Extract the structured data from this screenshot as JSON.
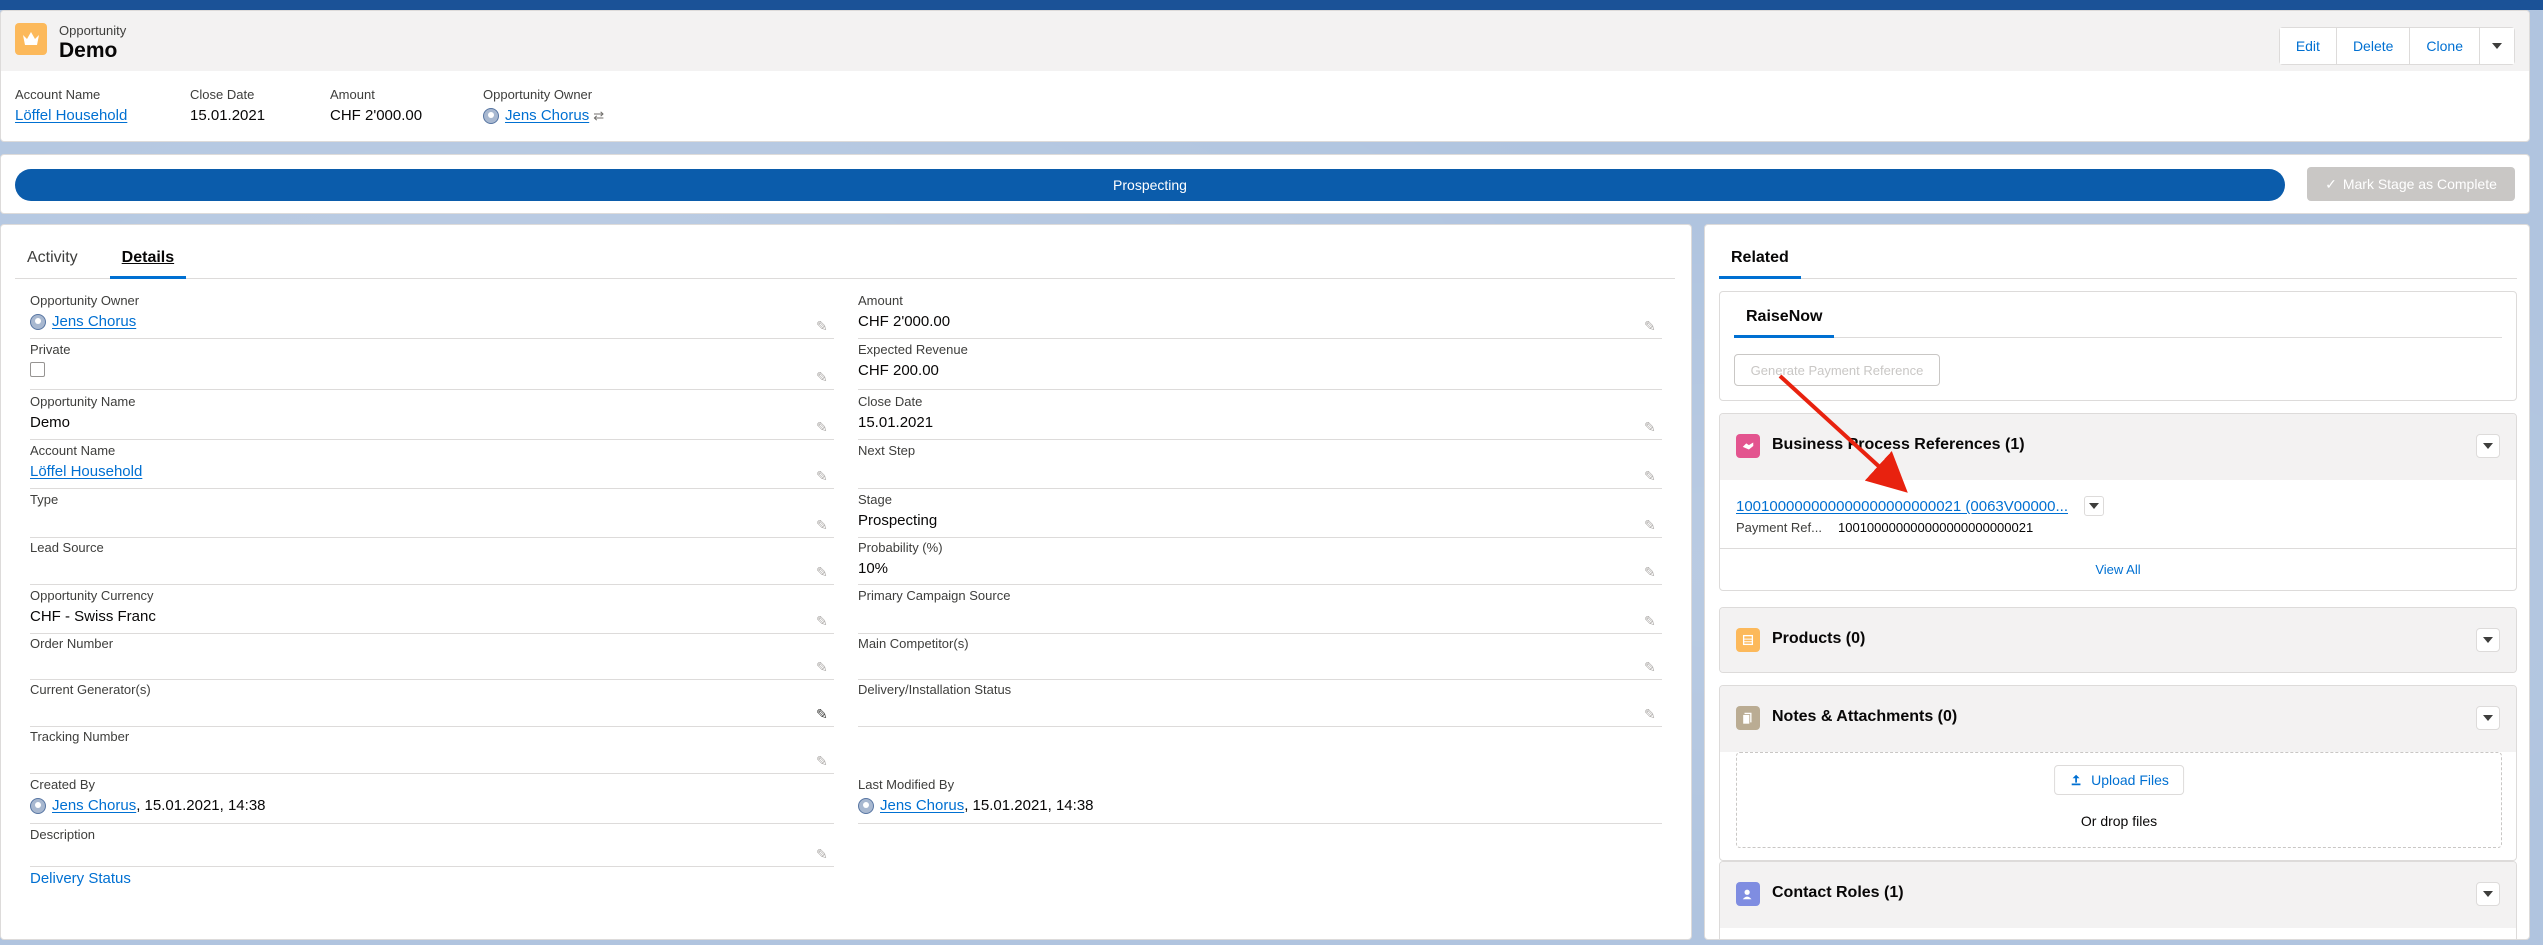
{
  "header": {
    "object_label": "Opportunity",
    "record_title": "Demo",
    "buttons": {
      "edit": "Edit",
      "delete": "Delete",
      "clone": "Clone"
    },
    "highlights": {
      "account_name_label": "Account Name",
      "account_name_value": "Löffel Household",
      "close_date_label": "Close Date",
      "close_date_value": "15.01.2021",
      "amount_label": "Amount",
      "amount_value": "CHF 2'000.00",
      "owner_label": "Opportunity Owner",
      "owner_value": "Jens Chorus"
    }
  },
  "path": {
    "current_stage": "Prospecting",
    "mark_complete_label": "Mark Stage as Complete"
  },
  "details": {
    "tabs": {
      "activity": "Activity",
      "details": "Details"
    },
    "left": [
      {
        "label": "Opportunity Owner",
        "value": "Jens Chorus"
      },
      {
        "label": "Private",
        "value": ""
      },
      {
        "label": "Opportunity Name",
        "value": "Demo"
      },
      {
        "label": "Account Name",
        "value": "Löffel Household"
      },
      {
        "label": "Type",
        "value": ""
      },
      {
        "label": "Lead Source",
        "value": ""
      },
      {
        "label": "Opportunity Currency",
        "value": "CHF - Swiss Franc"
      },
      {
        "label": "Order Number",
        "value": ""
      },
      {
        "label": "Current Generator(s)",
        "value": ""
      },
      {
        "label": "Tracking Number",
        "value": ""
      },
      {
        "label": "Created By",
        "value": "Jens Chorus",
        "suffix": ", 15.01.2021, 14:38"
      },
      {
        "label": "Description",
        "value": ""
      }
    ],
    "right": [
      {
        "label": "Amount",
        "value": "CHF 2'000.00"
      },
      {
        "label": "Expected Revenue",
        "value": "CHF 200.00"
      },
      {
        "label": "Close Date",
        "value": "15.01.2021"
      },
      {
        "label": "Next Step",
        "value": ""
      },
      {
        "label": "Stage",
        "value": "Prospecting"
      },
      {
        "label": "Probability (%)",
        "value": "10%"
      },
      {
        "label": "Primary Campaign Source",
        "value": ""
      },
      {
        "label": "Main Competitor(s)",
        "value": ""
      },
      {
        "label": "Delivery/Installation Status",
        "value": ""
      },
      {
        "label": "Last Modified By",
        "value": "Jens Chorus",
        "suffix": ", 15.01.2021, 14:38"
      }
    ],
    "section_link": "Delivery Status"
  },
  "related": {
    "tab": "Related",
    "raisenow": {
      "tab": "RaiseNow",
      "generate_button": "Generate Payment Reference"
    },
    "business_process_references": {
      "title": "Business Process References (1)",
      "record_link": "100100000000000000000000021 (0063V00000...",
      "field_label": "Payment Ref...",
      "field_value": "100100000000000000000000021",
      "view_all": "View All"
    },
    "products": {
      "title": "Products (0)"
    },
    "notes": {
      "title": "Notes & Attachments (0)",
      "upload_button": "Upload Files",
      "drop_text": "Or drop files"
    },
    "contact_roles": {
      "title": "Contact Roles (1)"
    }
  },
  "colors": {
    "brand_blue": "#0b5cab",
    "link_blue": "#0070d2",
    "opportunity_icon": "#fcb95b",
    "bpr_icon": "#e3548f",
    "products_icon": "#fcb95b",
    "notes_icon": "#baac93",
    "contact_roles_icon": "#7f8de1",
    "annotation_arrow": "#e8220f"
  }
}
